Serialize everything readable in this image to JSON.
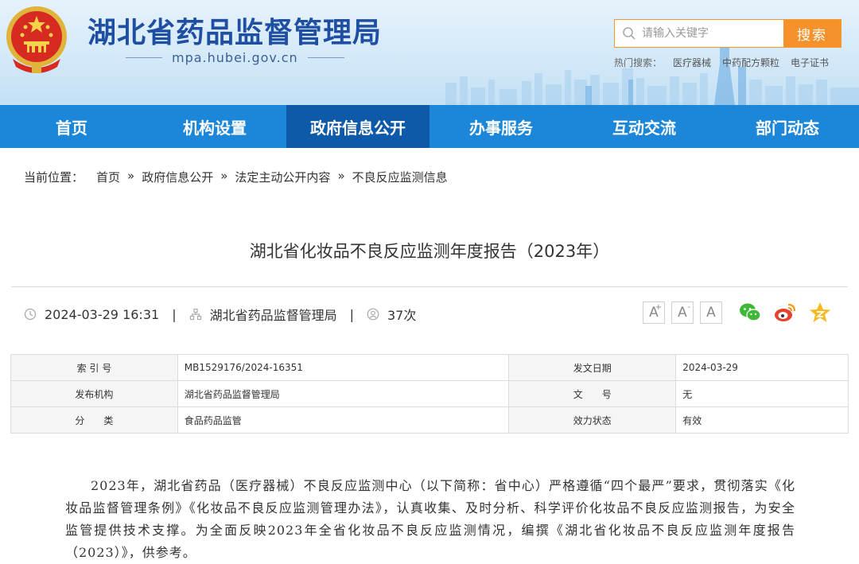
{
  "header": {
    "site_title": "湖北省药品监督管理局",
    "domain": "mpa.hubei.gov.cn",
    "search_placeholder": "请输入关键字",
    "search_button": "搜索",
    "hot_search_label": "热门搜索：",
    "hot_search_terms": [
      "医疗器械",
      "中药配方颗粒",
      "电子证书"
    ],
    "emblem_icon": "national-emblem-icon"
  },
  "nav": {
    "items": [
      {
        "label": "首页"
      },
      {
        "label": "机构设置"
      },
      {
        "label": "政府信息公开"
      },
      {
        "label": "办事服务"
      },
      {
        "label": "互动交流"
      },
      {
        "label": "部门动态"
      }
    ],
    "active_index": 2,
    "bar_color": "#1c87d9",
    "active_color": "#0f5aa8"
  },
  "breadcrumb": {
    "lead": "当前位置：",
    "items": [
      "首页",
      "政府信息公开",
      "法定主动公开内容",
      "不良反应监测信息"
    ],
    "separator": "»"
  },
  "article": {
    "title": "湖北省化妆品不良反应监测年度报告（2023年）",
    "date": "2024-03-29 16:31",
    "source": "湖北省药品监督管理局",
    "views": "37次",
    "meta_separator": "|",
    "font_sizes": [
      {
        "label": "A",
        "sup": "+"
      },
      {
        "label": "A",
        "sup": "-"
      },
      {
        "label": "A",
        "sup": ""
      }
    ],
    "share_icons": [
      "wechat-icon",
      "weibo-icon",
      "qzone-icon"
    ]
  },
  "info_table": {
    "rows": [
      {
        "label1": "索 引 号",
        "value1": "MB1529176/2024-16351",
        "label2": "发文日期",
        "value2": "2024-03-29"
      },
      {
        "label1": "发布机构",
        "value1": "湖北省药品监督管理局",
        "label2": "文　　号",
        "value2": "无"
      },
      {
        "label1": "分　　类",
        "value1": "食品药品监管",
        "label2": "效力状态",
        "value2": "有效"
      }
    ]
  },
  "body": {
    "paragraph": "2023年，湖北省药品（医疗器械）不良反应监测中心（以下简称：省中心）严格遵循“四个最严”要求，贯彻落实《化妆品监督管理条例》《化妆品不良反应监测管理办法》，认真收集、及时分析、科学评价化妆品不良反应监测报告，为安全监管提供技术支撑。为全面反映2023年全省化妆品不良反应监测情况，编撰《湖北省化妆品不良反应监测年度报告（2023）》，供参考。"
  }
}
